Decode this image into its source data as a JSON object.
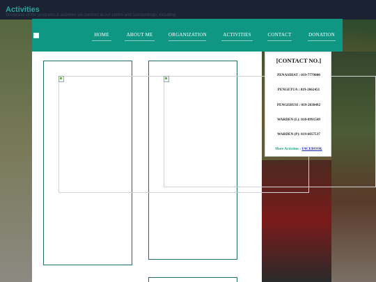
{
  "page": {
    "title": "Activities",
    "subtitle": "Showcase of the programs & activities we conduct at our centre and surroundings, including"
  },
  "nav": {
    "items": [
      {
        "label": "HOME"
      },
      {
        "label": "ABOUT ME"
      },
      {
        "label": "ORGANIZATION"
      },
      {
        "label": "ACTIVITIES"
      },
      {
        "label": "CONTACT"
      },
      {
        "label": "DONATION"
      }
    ]
  },
  "contact": {
    "title": "[CONTACT NO.]",
    "lines": [
      "PENASIHAT : 019-7779000",
      "PENGETUA : 019-2662451",
      "PENGERUSI : 019-2838492",
      "WARDEN (L): 018-8991549",
      "WARDEN (P): 019-6057537"
    ],
    "more_label": "More Activities :",
    "more_link": "FACEBOOK"
  },
  "colors": {
    "accent": "#0f9783",
    "title": "#23a6a0",
    "card_border": "#1f6b67"
  }
}
